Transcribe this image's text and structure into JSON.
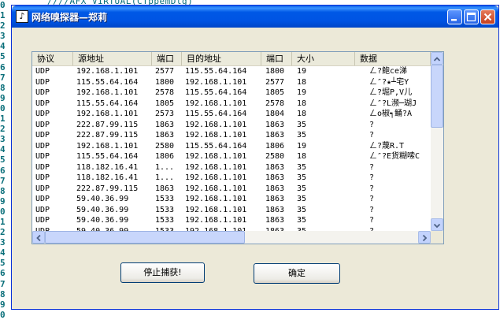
{
  "editor": {
    "gutter_digits": [
      "0",
      "1",
      "2",
      "3",
      "4",
      "5",
      "6",
      "7",
      "8",
      "9",
      "0",
      "1",
      "2",
      "3",
      "4",
      "5",
      "6",
      "7",
      "8",
      "9",
      "0",
      "1",
      "2",
      "3",
      "4",
      "5",
      "6",
      "7",
      "8",
      "9",
      "0"
    ],
    "code_text": "////AFX_VIRTUAL(CTppemDlg)"
  },
  "window": {
    "title": "网络嗅探器—郑莉",
    "icon_glyph": "♪"
  },
  "table": {
    "columns": [
      "协议",
      "源地址",
      "端口",
      "目的地址",
      "端口",
      "大小",
      "数据"
    ],
    "rows": [
      [
        "UDP",
        "192.168.1.101",
        "2577",
        "115.55.64.164",
        "1800",
        "19",
        "ㄥ?鲍ce涕"
      ],
      [
        "UDP",
        "115.55.64.164",
        "1800",
        "192.168.1.101",
        "2577",
        "18",
        "ㄥ″?★┴宅Y"
      ],
      [
        "UDP",
        "192.168.1.101",
        "2578",
        "115.55.64.164",
        "1805",
        "19",
        "ㄥ?堀P,V儿"
      ],
      [
        "UDP",
        "115.55.64.164",
        "1805",
        "192.168.1.101",
        "2578",
        "18",
        "ㄥ″?L濒─瑚J"
      ],
      [
        "UDP",
        "192.168.1.101",
        "2573",
        "115.55.64.164",
        "1804",
        "18",
        "ㄥo椒┑鲬?A"
      ],
      [
        "UDP",
        "222.87.99.115",
        "1863",
        "192.168.1.101",
        "1863",
        "35",
        "?"
      ],
      [
        "UDP",
        "222.87.99.115",
        "1863",
        "192.168.1.101",
        "1863",
        "35",
        "?"
      ],
      [
        "UDP",
        "192.168.1.101",
        "2580",
        "115.55.64.164",
        "1806",
        "19",
        "ㄥ?蔑R.T"
      ],
      [
        "UDP",
        "115.55.64.164",
        "1806",
        "192.168.1.101",
        "2580",
        "18",
        "ㄥ″?E货糊嗦C"
      ],
      [
        "UDP",
        "118.182.16.41",
        "1...",
        "192.168.1.101",
        "1863",
        "35",
        "?"
      ],
      [
        "UDP",
        "118.182.16.41",
        "1...",
        "192.168.1.101",
        "1863",
        "35",
        "?"
      ],
      [
        "UDP",
        "222.87.99.115",
        "1863",
        "192.168.1.101",
        "1863",
        "35",
        "?"
      ],
      [
        "UDP",
        "59.40.36.99",
        "1533",
        "192.168.1.101",
        "1863",
        "35",
        "?"
      ],
      [
        "UDP",
        "59.40.36.99",
        "1533",
        "192.168.1.101",
        "1863",
        "35",
        "?"
      ],
      [
        "UDP",
        "59.40.36.99",
        "1533",
        "192.168.1.101",
        "1863",
        "35",
        "?"
      ],
      [
        "UDP",
        "59.40.36.99",
        "1533",
        "192.168.1.101",
        "1863",
        "35",
        "?"
      ]
    ]
  },
  "buttons": {
    "stop_capture": "停止捕获!",
    "ok": "确定"
  },
  "icons": {
    "app": "app-icon",
    "minimize": "minimize-icon",
    "maximize": "maximize-icon",
    "close": "close-icon"
  },
  "colors": {
    "titlebar": "#0054e3",
    "window_bg": "#ece9d8",
    "code_text": "#0a6f7a",
    "close_button": "#c6401f"
  }
}
